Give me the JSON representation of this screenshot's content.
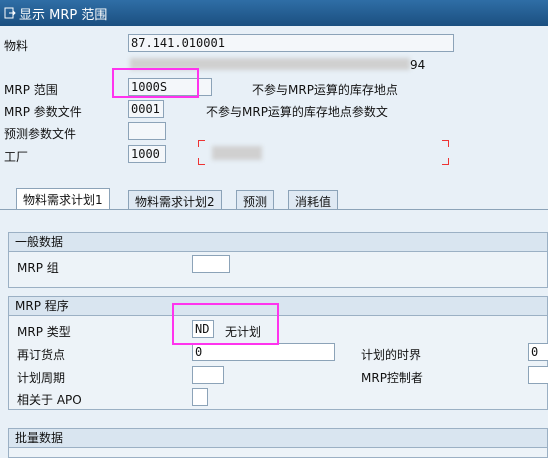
{
  "title": "显示 MRP 范围",
  "header": {
    "material_label": "物料",
    "material_value": "87.141.010001",
    "material_desc_suffix": "94",
    "mrp_area_label": "MRP 范围",
    "mrp_area_value": "1000S",
    "mrp_area_desc": "不参与MRP运算的库存地点",
    "mrp_profile_label": "MRP 参数文件",
    "mrp_profile_value": "0001",
    "mrp_profile_desc": "不参与MRP运算的库存地点参数文",
    "forecast_profile_label": "预测参数文件",
    "plant_label": "工厂",
    "plant_value": "1000"
  },
  "tabs": [
    "物料需求计划1",
    "物料需求计划2",
    "预测",
    "消耗值"
  ],
  "groups": {
    "general": {
      "title": "一般数据",
      "mrp_group_label": "MRP 组"
    },
    "procedure": {
      "title": "MRP 程序",
      "mrp_type_label": "MRP 类型",
      "mrp_type_value": "ND",
      "mrp_type_desc": "无计划",
      "reorder_label": "再订货点",
      "reorder_value": "0",
      "time_fence_label": "计划的时界",
      "time_fence_value": "0",
      "planning_cycle_label": "计划周期",
      "controller_label": "MRP控制者",
      "apo_label": "相关于 APO"
    },
    "lot_size": {
      "title": "批量数据"
    }
  },
  "colors": {
    "title_bar": "#1f5d93",
    "highlight": "#ff33ee"
  }
}
